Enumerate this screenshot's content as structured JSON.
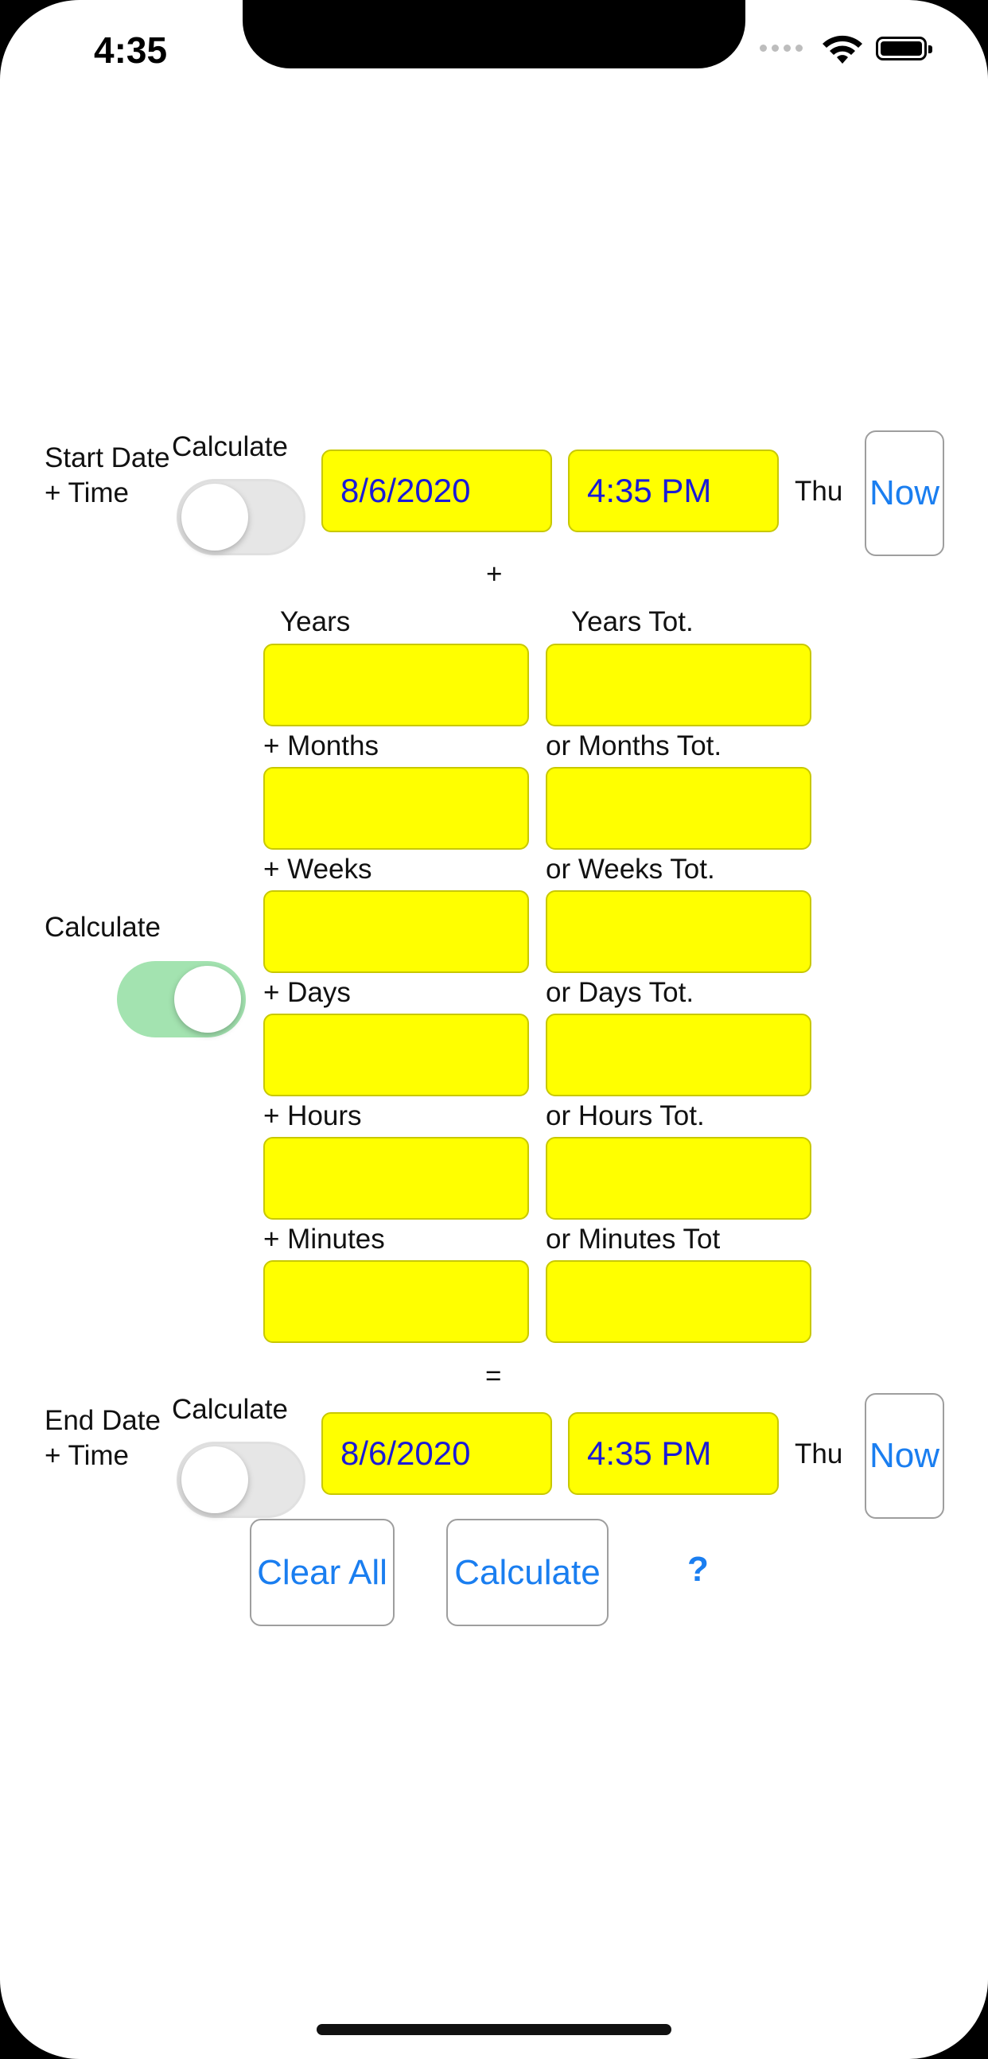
{
  "status_bar": {
    "time": "4:35"
  },
  "start": {
    "label": "Start Date + Time",
    "calc_label": "Calculate",
    "toggle_on": false,
    "date": "8/6/2020",
    "time": "4:35 PM",
    "weekday": "Thu",
    "now_label": "Now"
  },
  "plus_sign": "+",
  "duration": {
    "calc_label": "Calculate",
    "toggle_on": true,
    "rows": [
      {
        "left_label": "Years",
        "right_label": "Years Tot."
      },
      {
        "left_label": "+ Months",
        "right_label": "or Months Tot."
      },
      {
        "left_label": "+ Weeks",
        "right_label": "or Weeks Tot."
      },
      {
        "left_label": "+ Days",
        "right_label": "or Days Tot."
      },
      {
        "left_label": "+ Hours",
        "right_label": "or Hours Tot."
      },
      {
        "left_label": "+ Minutes",
        "right_label": "or Minutes Tot"
      }
    ]
  },
  "equals_sign": "=",
  "end": {
    "label": "End Date + Time",
    "calc_label": "Calculate",
    "toggle_on": false,
    "date": "8/6/2020",
    "time": "4:35 PM",
    "weekday": "Thu",
    "now_label": "Now"
  },
  "actions": {
    "clear_all": "Clear All",
    "calculate": "Calculate",
    "help": "?"
  },
  "colors": {
    "field_bg": "#ffff00",
    "field_text": "#1a1ad8",
    "link_blue": "#1a7ef0",
    "toggle_on": "#a3e3b0"
  }
}
